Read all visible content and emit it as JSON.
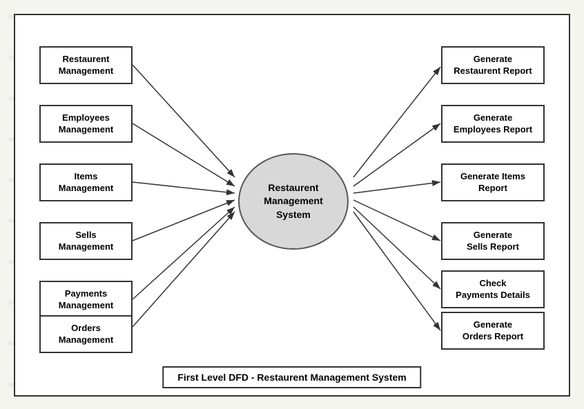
{
  "watermark": {
    "text": "www.freeprojectz.com"
  },
  "diagram": {
    "title": "First Level DFD - Restaurent Management System",
    "center": {
      "label": "Restaurent\nManagement\nSystem"
    },
    "left_boxes": [
      {
        "id": "left1",
        "label": "Restaurent\nManagement"
      },
      {
        "id": "left2",
        "label": "Employees\nManagement"
      },
      {
        "id": "left3",
        "label": "Items\nManagement"
      },
      {
        "id": "left4",
        "label": "Sells\nManagement"
      },
      {
        "id": "left5",
        "label": "Payments\nManagement"
      },
      {
        "id": "left6",
        "label": "Orders\nManagement"
      }
    ],
    "right_boxes": [
      {
        "id": "right1",
        "label": "Generate\nRestaurent Report"
      },
      {
        "id": "right2",
        "label": "Generate\nEmployees Report"
      },
      {
        "id": "right3",
        "label": "Generate Items\nReport"
      },
      {
        "id": "right4",
        "label": "Generate\nSells Report"
      },
      {
        "id": "right5",
        "label": "Check\nPayments Details"
      },
      {
        "id": "right6",
        "label": "Generate\nOrders Report"
      }
    ]
  }
}
